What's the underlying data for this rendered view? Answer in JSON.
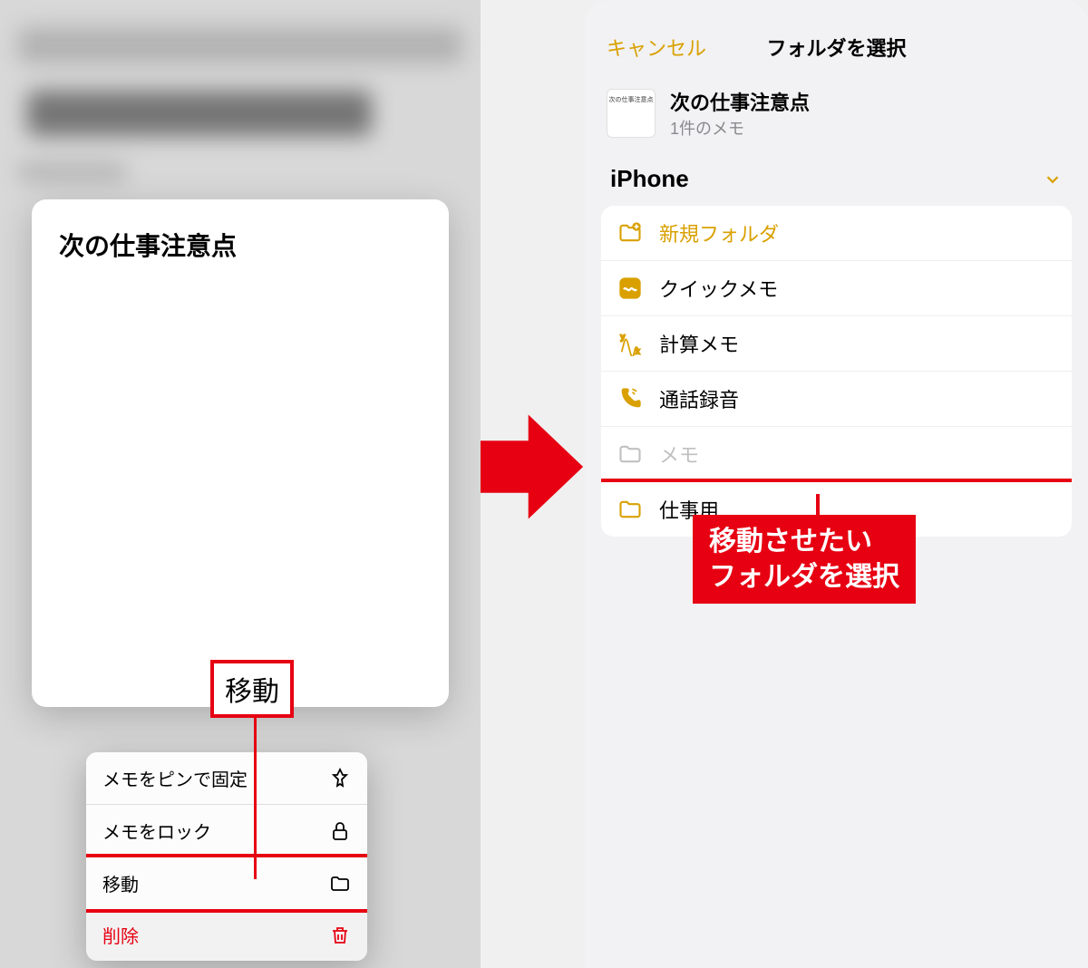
{
  "left": {
    "note_title": "次の仕事注意点",
    "move_label": "移動",
    "menu": {
      "pin": "メモをピンで固定",
      "lock": "メモをロック",
      "move": "移動",
      "delete": "削除"
    }
  },
  "right": {
    "cancel": "キャンセル",
    "title": "フォルダを選択",
    "note_name": "次の仕事注意点",
    "note_count": "1件のメモ",
    "section": "iPhone",
    "folders": {
      "new_folder": "新規フォルダ",
      "quick_memo": "クイックメモ",
      "calc_memo": "計算メモ",
      "call_rec": "通話録音",
      "memo": "メモ",
      "work": "仕事用"
    }
  },
  "annotation": {
    "line1": "移動させたい",
    "line2": "フォルダを選択"
  }
}
